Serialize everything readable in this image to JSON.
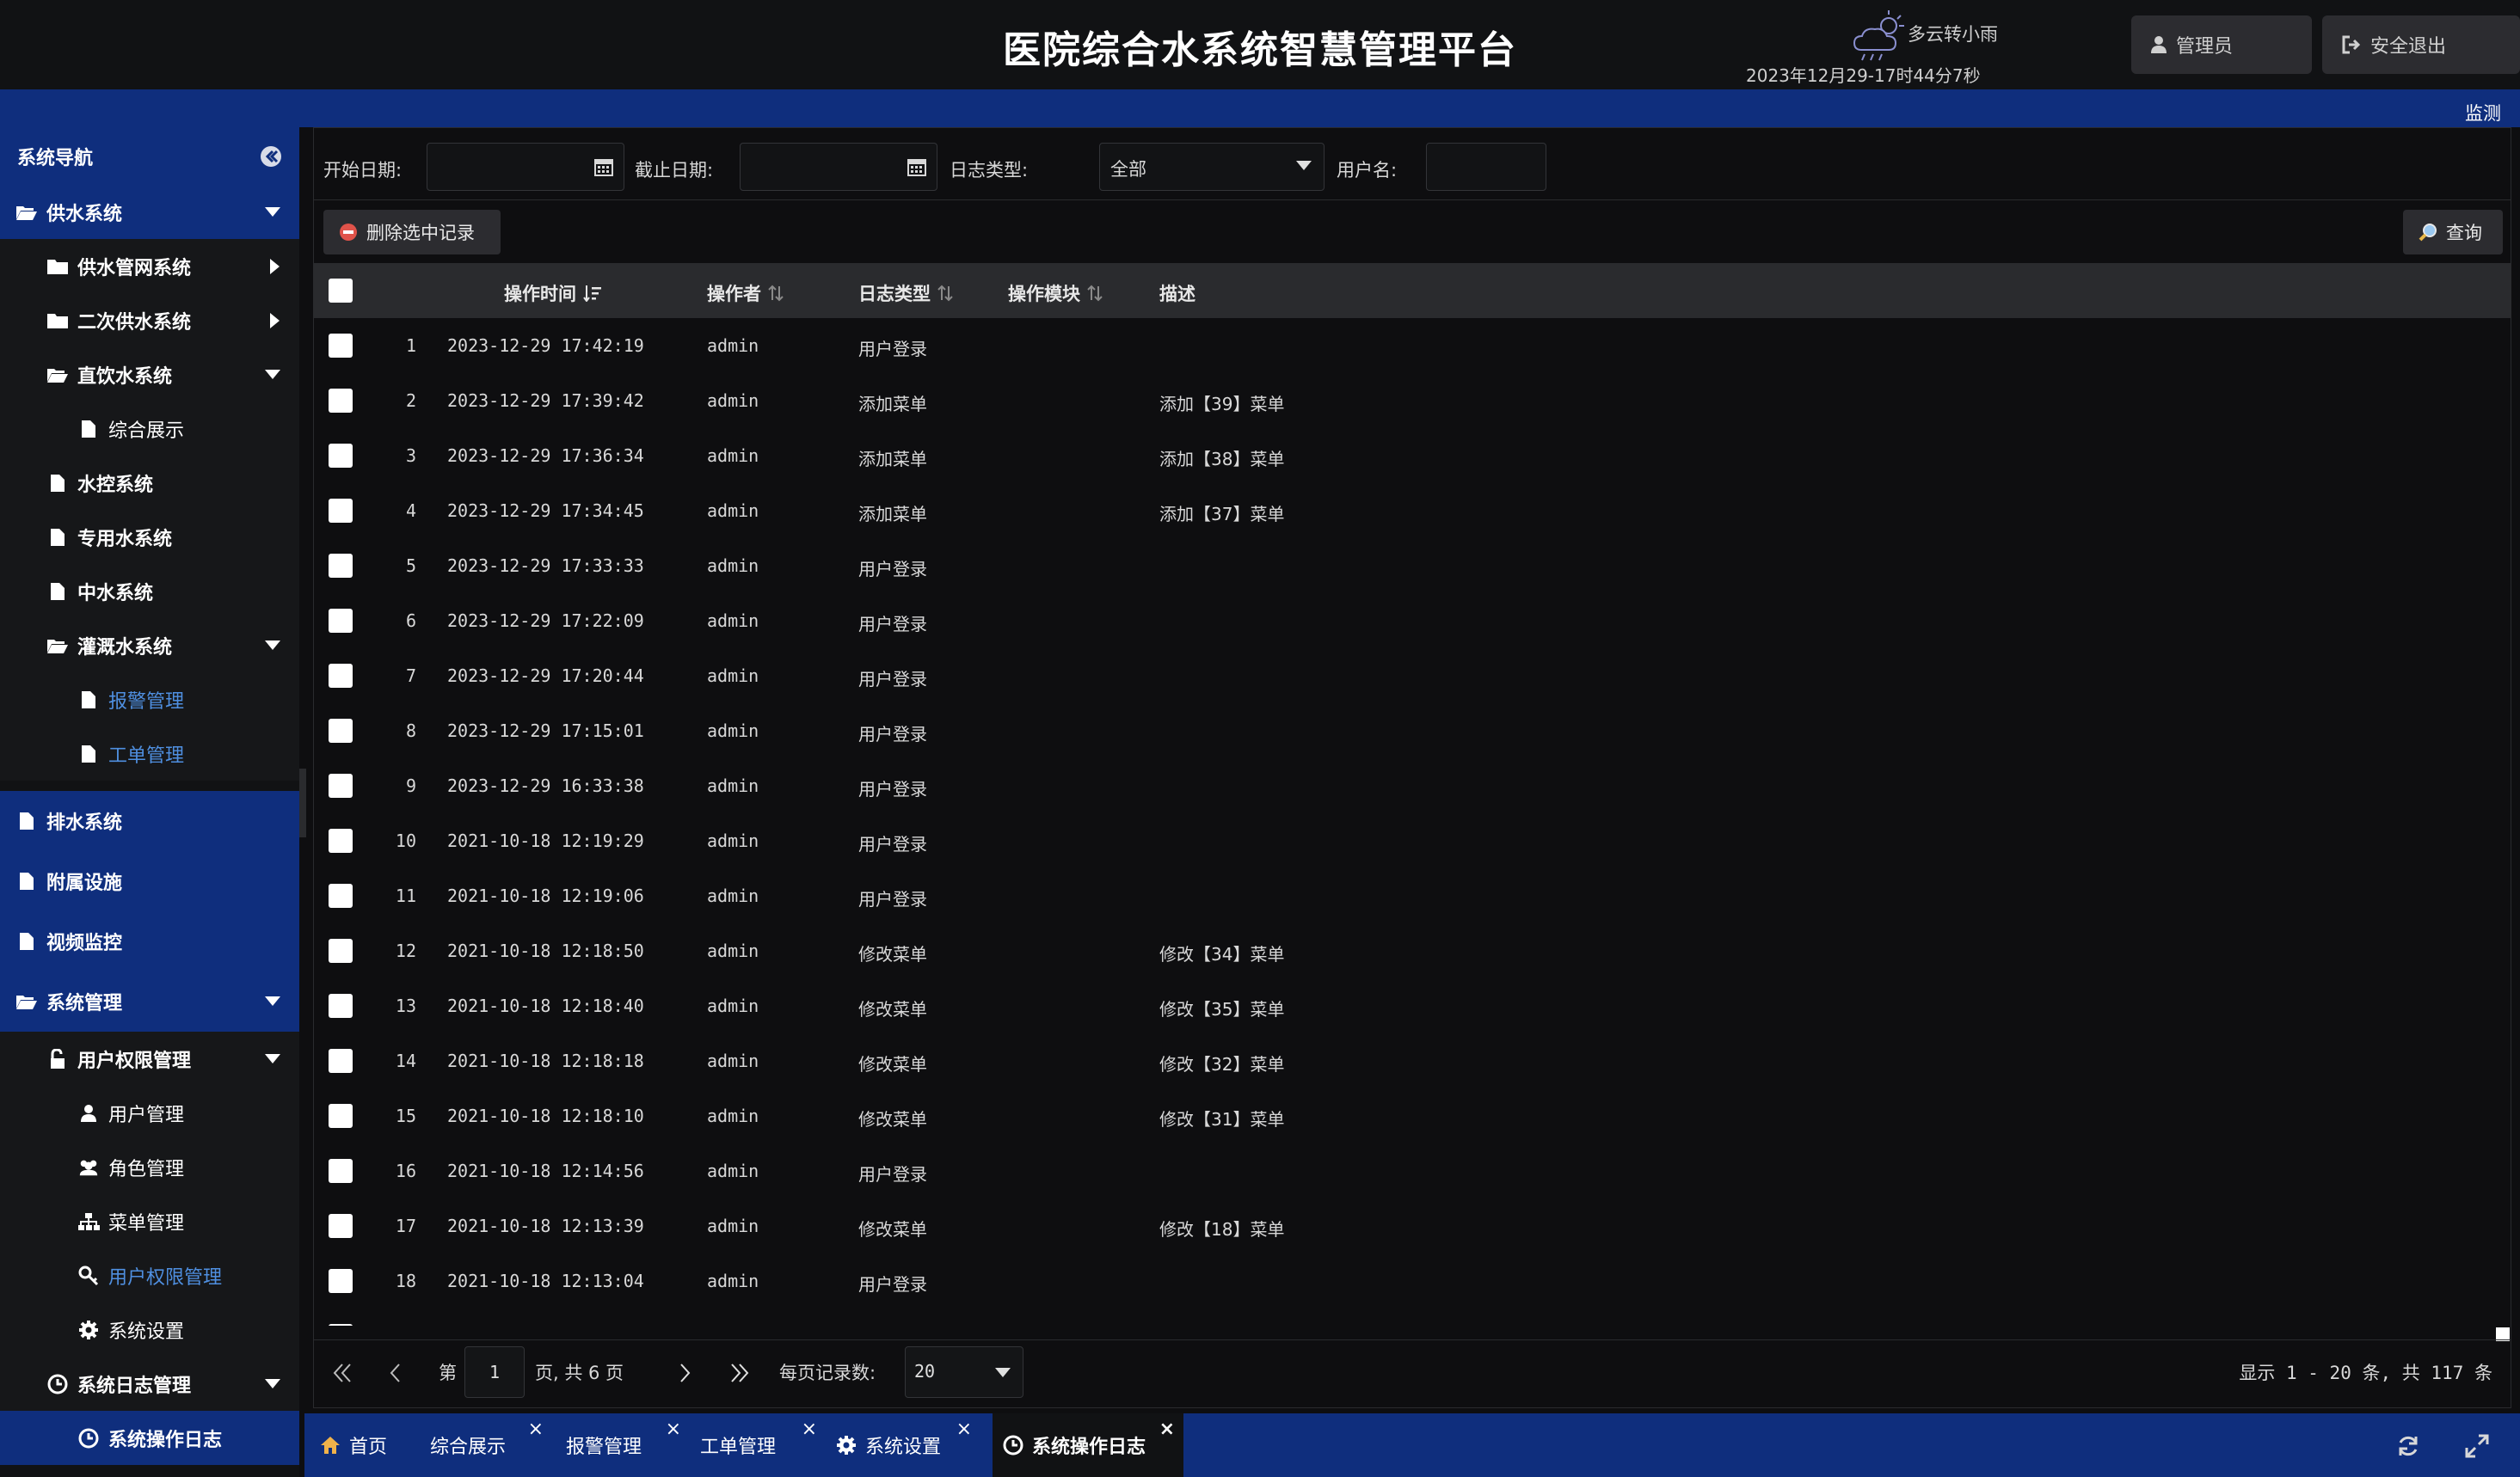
{
  "header": {
    "title": "医院综合水系统智慧管理平台",
    "weather": "多云转小雨",
    "datetime": "2023年12月29-17时44分7秒",
    "admin_label": "管理员",
    "logout_label": "安全退出"
  },
  "strip": {
    "label": "监测"
  },
  "sidebar": {
    "title": "系统导航",
    "items": [
      {
        "label": "供水系统"
      },
      {
        "label": "供水管网系统"
      },
      {
        "label": "二次供水系统"
      },
      {
        "label": "直饮水系统"
      },
      {
        "label": "综合展示"
      },
      {
        "label": "水控系统"
      },
      {
        "label": "专用水系统"
      },
      {
        "label": "中水系统"
      },
      {
        "label": "灌溉水系统"
      },
      {
        "label": "报警管理"
      },
      {
        "label": "工单管理"
      },
      {
        "label": "排水系统"
      },
      {
        "label": "附属设施"
      },
      {
        "label": "视频监控"
      },
      {
        "label": "系统管理"
      },
      {
        "label": "用户权限管理"
      },
      {
        "label": "用户管理"
      },
      {
        "label": "角色管理"
      },
      {
        "label": "菜单管理"
      },
      {
        "label": "用户权限管理"
      },
      {
        "label": "系统设置"
      },
      {
        "label": "系统日志管理"
      },
      {
        "label": "系统操作日志"
      }
    ]
  },
  "filters": {
    "start_date_label": "开始日期:",
    "end_date_label": "截止日期:",
    "log_type_label": "日志类型:",
    "log_type_value": "全部",
    "username_label": "用户名:"
  },
  "toolbar": {
    "delete_label": "删除选中记录",
    "query_label": "查询"
  },
  "grid": {
    "columns": {
      "time": "操作时间",
      "operator": "操作者",
      "log_type": "日志类型",
      "module": "操作模块",
      "desc": "描述"
    },
    "rows": [
      {
        "n": "1",
        "time": "2023-12-29 17:42:19",
        "operator": "admin",
        "type": "用户登录",
        "desc": ""
      },
      {
        "n": "2",
        "time": "2023-12-29 17:39:42",
        "operator": "admin",
        "type": "添加菜单",
        "desc": "添加【39】菜单"
      },
      {
        "n": "3",
        "time": "2023-12-29 17:36:34",
        "operator": "admin",
        "type": "添加菜单",
        "desc": "添加【38】菜单"
      },
      {
        "n": "4",
        "time": "2023-12-29 17:34:45",
        "operator": "admin",
        "type": "添加菜单",
        "desc": "添加【37】菜单"
      },
      {
        "n": "5",
        "time": "2023-12-29 17:33:33",
        "operator": "admin",
        "type": "用户登录",
        "desc": ""
      },
      {
        "n": "6",
        "time": "2023-12-29 17:22:09",
        "operator": "admin",
        "type": "用户登录",
        "desc": ""
      },
      {
        "n": "7",
        "time": "2023-12-29 17:20:44",
        "operator": "admin",
        "type": "用户登录",
        "desc": ""
      },
      {
        "n": "8",
        "time": "2023-12-29 17:15:01",
        "operator": "admin",
        "type": "用户登录",
        "desc": ""
      },
      {
        "n": "9",
        "time": "2023-12-29 16:33:38",
        "operator": "admin",
        "type": "用户登录",
        "desc": ""
      },
      {
        "n": "10",
        "time": "2021-10-18 12:19:29",
        "operator": "admin",
        "type": "用户登录",
        "desc": ""
      },
      {
        "n": "11",
        "time": "2021-10-18 12:19:06",
        "operator": "admin",
        "type": "用户登录",
        "desc": ""
      },
      {
        "n": "12",
        "time": "2021-10-18 12:18:50",
        "operator": "admin",
        "type": "修改菜单",
        "desc": "修改【34】菜单"
      },
      {
        "n": "13",
        "time": "2021-10-18 12:18:40",
        "operator": "admin",
        "type": "修改菜单",
        "desc": "修改【35】菜单"
      },
      {
        "n": "14",
        "time": "2021-10-18 12:18:18",
        "operator": "admin",
        "type": "修改菜单",
        "desc": "修改【32】菜单"
      },
      {
        "n": "15",
        "time": "2021-10-18 12:18:10",
        "operator": "admin",
        "type": "修改菜单",
        "desc": "修改【31】菜单"
      },
      {
        "n": "16",
        "time": "2021-10-18 12:14:56",
        "operator": "admin",
        "type": "用户登录",
        "desc": ""
      },
      {
        "n": "17",
        "time": "2021-10-18 12:13:39",
        "operator": "admin",
        "type": "修改菜单",
        "desc": "修改【18】菜单"
      },
      {
        "n": "18",
        "time": "2021-10-18 12:13:04",
        "operator": "admin",
        "type": "用户登录",
        "desc": ""
      }
    ]
  },
  "pager": {
    "page_prefix": "第",
    "page_value": "1",
    "page_suffix": "页, 共 6 页",
    "page_size_label": "每页记录数:",
    "page_size_value": "20",
    "summary": "显示 1 - 20 条, 共 117 条"
  },
  "tabs": [
    {
      "label": "首页",
      "icon": "home-icon"
    },
    {
      "label": "综合展示"
    },
    {
      "label": "报警管理"
    },
    {
      "label": "工单管理"
    },
    {
      "label": "系统设置",
      "icon": "gear-icon"
    },
    {
      "label": "系统操作日志",
      "icon": "clock-icon"
    }
  ],
  "colors": {
    "accent_blue": "#0f2e7d",
    "link_blue": "#4f8fe0",
    "background": "#0e0e10"
  }
}
